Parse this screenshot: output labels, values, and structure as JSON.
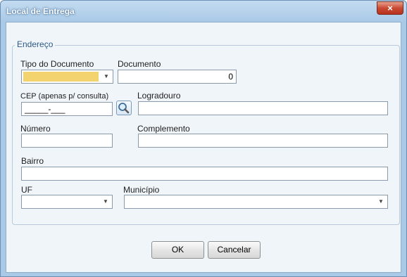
{
  "window": {
    "title": "Local de Entrega",
    "close_label": "×"
  },
  "group": {
    "legend": "Endereço"
  },
  "form": {
    "tipo_documento": {
      "label": "Tipo do Documento",
      "value": ""
    },
    "documento": {
      "label": "Documento",
      "value": "0"
    },
    "cep": {
      "label": "CEP (apenas p/ consulta)",
      "value": "_____-___"
    },
    "logradouro": {
      "label": "Logradouro",
      "value": ""
    },
    "numero": {
      "label": "Número",
      "value": ""
    },
    "complemento": {
      "label": "Complemento",
      "value": ""
    },
    "bairro": {
      "label": "Bairro",
      "value": ""
    },
    "uf": {
      "label": "UF",
      "value": ""
    },
    "municipio": {
      "label": "Município",
      "value": ""
    }
  },
  "buttons": {
    "ok": "OK",
    "cancel": "Cancelar"
  },
  "icons": {
    "search": "magnifier-icon",
    "dropdown": "chevron-down-icon",
    "close": "close-icon"
  },
  "colors": {
    "required_field": "#f2d36e",
    "close_button": "#c94a33",
    "legend_text": "#2f5a88"
  }
}
